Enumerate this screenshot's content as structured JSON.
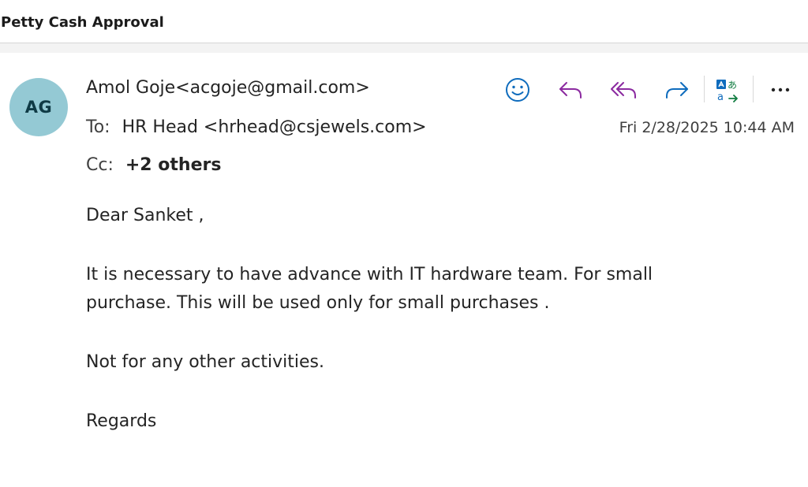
{
  "email": {
    "subject": "Petty Cash Approval",
    "sender": {
      "initials": "AG",
      "name": "Amol Goje",
      "address": "<acgoje@gmail.com>",
      "avatar_color": "#94c9d4"
    },
    "to": {
      "label": "To:",
      "value": "HR Head <hrhead@csjewels.com>"
    },
    "cc": {
      "label": "Cc:",
      "value": "+2 others"
    },
    "date": "Fri 2/28/2025 10:44 AM",
    "body": {
      "greeting": "Dear Sanket ,",
      "paragraph1_line1": "It is necessary to have advance with IT hardware team.  For small",
      "paragraph1_line2": "purchase.  This will be used only for small purchases .",
      "paragraph2": "Not for any other activities.",
      "closing": "Regards"
    }
  },
  "toolbar": {
    "icons": [
      "smiley-icon",
      "reply-icon",
      "reply-all-icon",
      "forward-icon",
      "translate-icon",
      "more-icon"
    ],
    "colors": {
      "smiley": "#0f6cbd",
      "reply": "#8b2aa0",
      "forward": "#0f6cbd",
      "translate_blue": "#0f6cbd",
      "translate_green": "#107c41"
    }
  }
}
